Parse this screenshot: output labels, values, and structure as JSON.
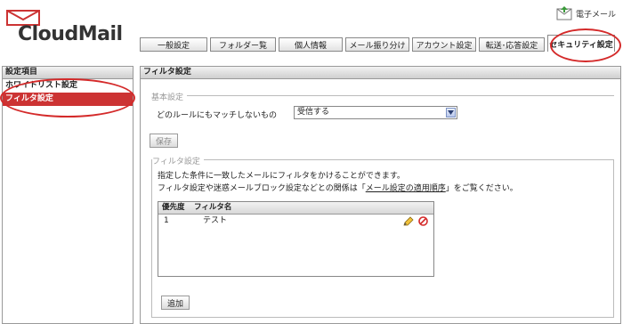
{
  "app": {
    "logo_text": "CloudMail",
    "email_link": "電子メール"
  },
  "tabs": [
    {
      "label": "一般設定"
    },
    {
      "label": "フォルダー覧"
    },
    {
      "label": "個人情報"
    },
    {
      "label": "メール振り分け"
    },
    {
      "label": "アカウント設定"
    },
    {
      "label": "転送･応答設定"
    },
    {
      "label": "セキュリティ設定"
    }
  ],
  "sidebar": {
    "header": "設定項目",
    "items": [
      {
        "label": "ホワイトリスト設定"
      },
      {
        "label": "フィルタ設定"
      }
    ]
  },
  "main": {
    "header": "フィルタ設定",
    "basic": {
      "legend": "基本設定",
      "rule_label": "どのルールにもマッチしないもの",
      "select_value": "受信する",
      "save_label": "保存"
    },
    "filter": {
      "legend": "フィルタ設定",
      "desc1": "指定した条件に一致したメールにフィルタをかけることができます。",
      "desc2_prefix": "フィルタ設定や迷惑メールブロック設定などとの関係は「",
      "desc2_link": "メール設定の適用順序",
      "desc2_suffix": "」をご覧ください。",
      "table": {
        "headers": {
          "priority": "優先度",
          "name": "フィルタ名"
        },
        "rows": [
          {
            "priority": "1",
            "name": "テスト"
          }
        ]
      },
      "add_label": "追加"
    }
  },
  "colors": {
    "accent": "#cc3333",
    "annotation": "#d42a2a"
  }
}
